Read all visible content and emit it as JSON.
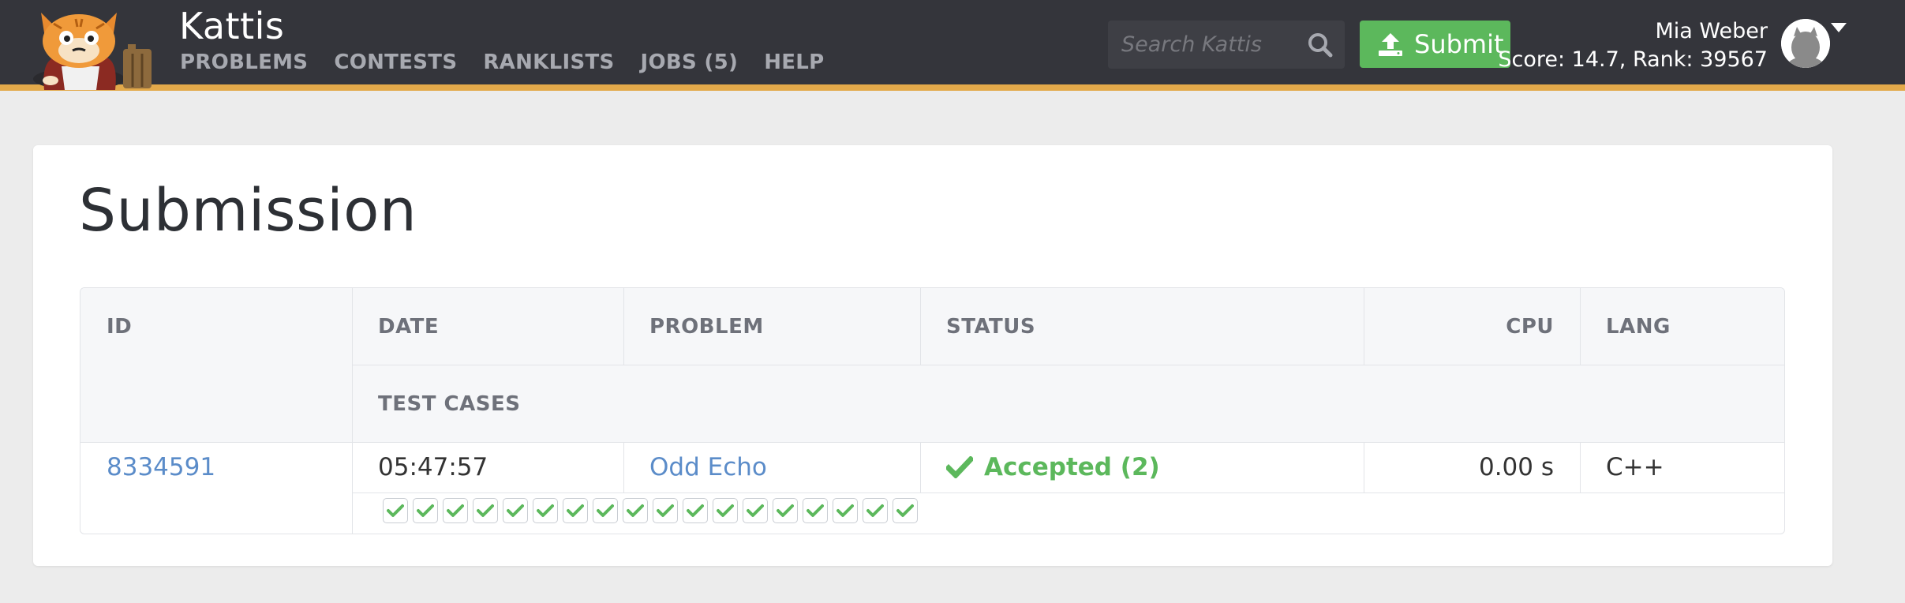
{
  "header": {
    "brand": "Kattis",
    "nav": [
      {
        "label": "PROBLEMS"
      },
      {
        "label": "CONTESTS"
      },
      {
        "label": "RANKLISTS"
      },
      {
        "label": "JOBS (5)"
      },
      {
        "label": "HELP"
      }
    ],
    "search": {
      "placeholder": "Search Kattis",
      "icon": "search-icon"
    },
    "submit_label": "Submit",
    "user": {
      "name": "Mia Weber",
      "score_line": "Score: 14.7, Rank: 39567"
    }
  },
  "page": {
    "title": "Submission"
  },
  "table": {
    "headers": {
      "id": "ID",
      "date": "DATE",
      "problem": "PROBLEM",
      "status": "STATUS",
      "cpu": "CPU",
      "lang": "LANG",
      "test_cases": "TEST CASES"
    },
    "row": {
      "id": "8334591",
      "date": "05:47:57",
      "problem": "Odd Echo",
      "status": "Accepted (2)",
      "cpu": "0.00 s",
      "lang": "C++"
    },
    "test_case_count": 18,
    "test_case_status": "accepted"
  },
  "colors": {
    "topbar": "#34353b",
    "accent_border": "#e3a94a",
    "success": "#5cb85c",
    "link": "#5b8cc9"
  }
}
